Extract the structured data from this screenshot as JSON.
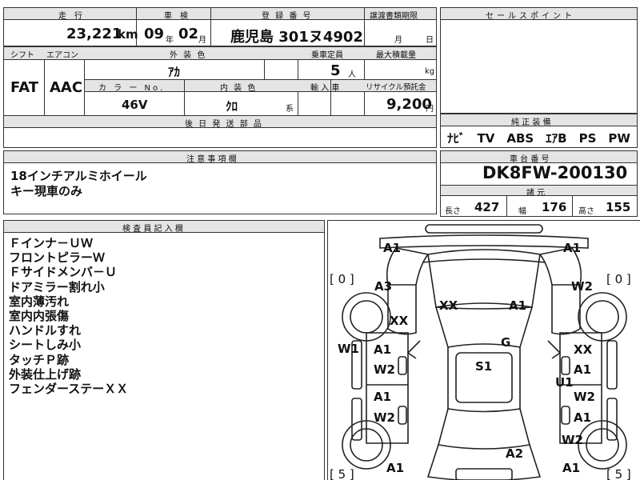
{
  "header_row": {
    "mileage_label": "走　行",
    "inspection_label": "車　検",
    "registration_label": "登 録 番 号",
    "transfer_label": "譲渡書類期限",
    "mileage_value": "23,221",
    "mileage_unit": "km",
    "inspection_year": "09",
    "inspection_year_unit": "年",
    "inspection_month": "02",
    "inspection_month_unit": "月",
    "registration_value": "鹿児島 301ヌ4902",
    "transfer_month_unit": "月",
    "transfer_day_unit": "日"
  },
  "spec_row": {
    "shift_label": "シフト",
    "aircon_label": "エアコン",
    "exterior_color_label": "外 装 色",
    "capacity_label": "乗車定員",
    "max_load_label": "最大積載量",
    "shift_value": "FAT",
    "aircon_value": "AAC",
    "exterior_color_value": "ｱｶ",
    "capacity_value": "5",
    "capacity_unit": "人",
    "max_load_unit": "kg",
    "color_no_label": "カ ラ ー No.",
    "interior_color_label": "内 装 色",
    "import_label": "輸 入 車",
    "recycle_label": "リサイクル預託金",
    "color_no_value": "46V",
    "interior_color_value": "ｸﾛ",
    "interior_color_suffix": "系",
    "recycle_value": "9,200",
    "recycle_unit": "円",
    "shipping_label": "後 日 発 送 部 品"
  },
  "sales_point": {
    "title": "セールスポイント"
  },
  "standard_equipment": {
    "title": "純 正 装 備",
    "value": "ﾅﾋﾞ　TV　ABS　ｴｱB　PS　PW"
  },
  "notes": {
    "title": "注 意 事 項 欄",
    "lines": [
      "18インチアルミホイール",
      "キー現車のみ"
    ]
  },
  "chassis": {
    "title": "車 台 番 号",
    "value": "DK8FW-200130",
    "dims_title": "諸 元",
    "length_label": "長さ",
    "length_value": "427",
    "width_label": "幅",
    "width_value": "176",
    "height_label": "高さ",
    "height_value": "155"
  },
  "inspector": {
    "title": "検 査 員 記 入 欄",
    "lines": [
      "Ｆインナ－ＵＷ",
      "フロントピラーＷ",
      "Ｆサイドメンバ－Ｕ",
      "ドアミラー割れ小",
      "室内薄汚れ",
      "室内内張傷",
      "ハンドルすれ",
      "シートしみ小",
      "タッチＰ跡",
      "外装仕上げ跡",
      "フェンダーステーＸＸ"
    ]
  },
  "diagram": {
    "brackets": [
      "[ 0 ]",
      "[ 0 ]",
      "[ 5 ]",
      "[ 5 ]"
    ],
    "marks": [
      "A1",
      "A1",
      "A3",
      "W2",
      "XX",
      "A1",
      "XX",
      "G",
      "W1",
      "A1",
      "XX",
      "W2",
      "S1",
      "A1",
      "U1",
      "A1",
      "W2",
      "W2",
      "A1",
      "W2",
      "A2",
      "A1",
      "A1"
    ]
  }
}
